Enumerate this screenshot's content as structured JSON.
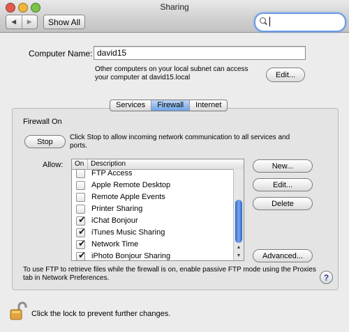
{
  "window": {
    "title": "Sharing",
    "traffic_colors": {
      "close": "#e25c4e",
      "minimize": "#f0b43a",
      "zoom": "#7cc24b"
    }
  },
  "toolbar": {
    "back_glyph": "◀",
    "forward_glyph": "▶",
    "show_all_label": "Show All",
    "search_value": ""
  },
  "computer": {
    "name_label": "Computer Name:",
    "name_value": "david15",
    "info_line1": "Other computers on your local subnet can access",
    "info_line2": "your computer at david15.local",
    "edit_label": "Edit..."
  },
  "tabs": [
    {
      "label": "Services",
      "active": false
    },
    {
      "label": "Firewall",
      "active": true
    },
    {
      "label": "Internet",
      "active": false
    }
  ],
  "firewall": {
    "status": "Firewall On",
    "stop_label": "Stop",
    "stop_desc_line1": "Click Stop to allow incoming network communication to all services and",
    "stop_desc_line2": "ports.",
    "allow_label": "Allow:",
    "columns": {
      "on": "On",
      "description": "Description"
    },
    "rows": [
      {
        "label": "FTP Access",
        "checked": false
      },
      {
        "label": "Apple Remote Desktop",
        "checked": false
      },
      {
        "label": "Remote Apple Events",
        "checked": false
      },
      {
        "label": "Printer Sharing",
        "checked": false
      },
      {
        "label": "iChat Bonjour",
        "checked": true
      },
      {
        "label": "iTunes Music Sharing",
        "checked": true
      },
      {
        "label": "Network Time",
        "checked": true
      },
      {
        "label": "iPhoto Bonjour Sharing",
        "checked": true
      }
    ],
    "new_label": "New...",
    "edit_label": "Edit...",
    "delete_label": "Delete",
    "advanced_label": "Advanced...",
    "ftp_note_line1": "To use FTP to retrieve files while the firewall is on, enable passive FTP mode using the Proxies",
    "ftp_note_line2": "tab in Network Preferences.",
    "help_glyph": "?"
  },
  "footer": {
    "lock_text": "Click the lock to prevent further changes."
  },
  "icons": [
    "search-icon",
    "lock-icon",
    "help-icon",
    "checkmark-icon"
  ],
  "accent_color": "#6ea2e6"
}
